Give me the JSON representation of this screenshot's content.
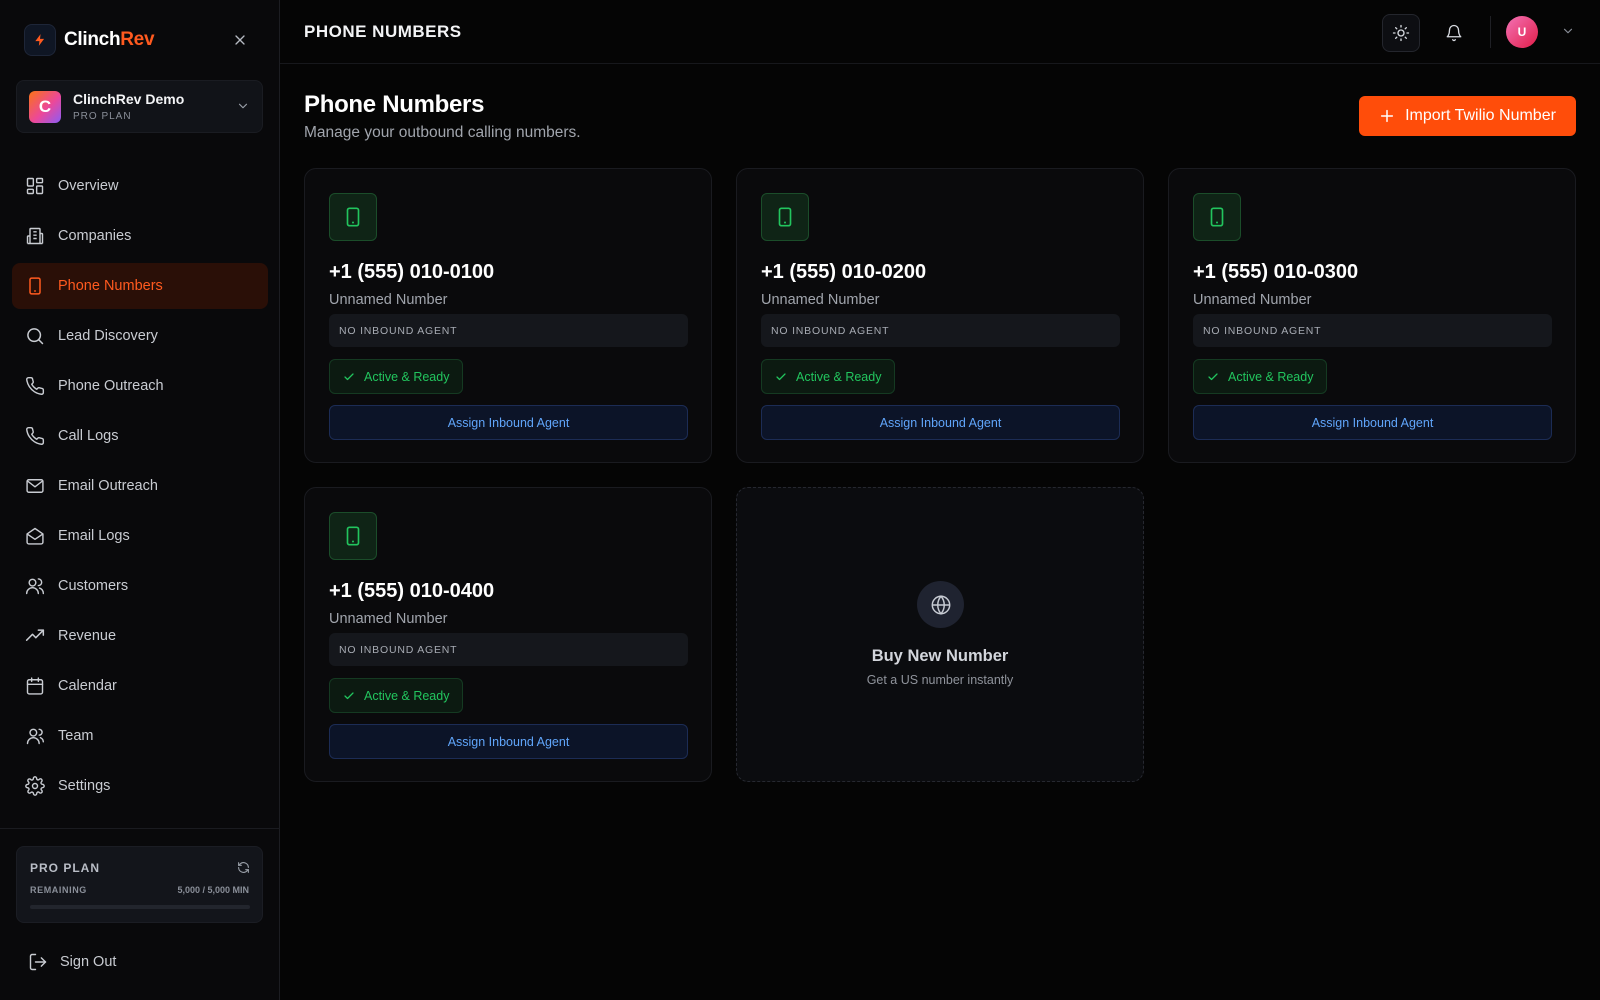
{
  "brand": {
    "name_part1": "Clinch",
    "name_part2": "Rev"
  },
  "workspace": {
    "initial": "C",
    "name": "ClinchRev Demo",
    "plan": "PRO PLAN"
  },
  "nav": {
    "items": [
      {
        "label": "Overview",
        "icon": "grid-icon"
      },
      {
        "label": "Companies",
        "icon": "building-icon"
      },
      {
        "label": "Phone Numbers",
        "icon": "smartphone-icon",
        "active": true
      },
      {
        "label": "Lead Discovery",
        "icon": "search-icon"
      },
      {
        "label": "Phone Outreach",
        "icon": "phone-icon"
      },
      {
        "label": "Call Logs",
        "icon": "phone-icon"
      },
      {
        "label": "Email Outreach",
        "icon": "mail-icon"
      },
      {
        "label": "Email Logs",
        "icon": "mail-open-icon"
      },
      {
        "label": "Customers",
        "icon": "users-icon"
      },
      {
        "label": "Revenue",
        "icon": "trending-up-icon"
      },
      {
        "label": "Calendar",
        "icon": "calendar-icon"
      },
      {
        "label": "Team",
        "icon": "team-icon"
      },
      {
        "label": "Settings",
        "icon": "gear-icon"
      }
    ]
  },
  "plan_card": {
    "title": "PRO PLAN",
    "remaining_label": "REMAINING",
    "usage": "5,000 / 5,000 MIN"
  },
  "signout": {
    "label": "Sign Out"
  },
  "header": {
    "title": "PHONE NUMBERS",
    "user_initial": "U"
  },
  "main": {
    "title": "Phone Numbers",
    "subtitle": "Manage your outbound calling numbers.",
    "import_button": "Import Twilio Number"
  },
  "cards": [
    {
      "number": "+1 (555) 010-0100",
      "name": "Unnamed Number",
      "agent": "NO INBOUND AGENT",
      "status": "Active & Ready",
      "action": "Assign Inbound Agent"
    },
    {
      "number": "+1 (555) 010-0200",
      "name": "Unnamed Number",
      "agent": "NO INBOUND AGENT",
      "status": "Active & Ready",
      "action": "Assign Inbound Agent"
    },
    {
      "number": "+1 (555) 010-0300",
      "name": "Unnamed Number",
      "agent": "NO INBOUND AGENT",
      "status": "Active & Ready",
      "action": "Assign Inbound Agent"
    },
    {
      "number": "+1 (555) 010-0400",
      "name": "Unnamed Number",
      "agent": "NO INBOUND AGENT",
      "status": "Active & Ready",
      "action": "Assign Inbound Agent"
    }
  ],
  "buy_card": {
    "title": "Buy New Number",
    "subtitle": "Get a US number instantly"
  },
  "colors": {
    "accent": "#ff4d0a",
    "success": "#22c55e",
    "link": "#60a5fa",
    "background": "#050505"
  }
}
